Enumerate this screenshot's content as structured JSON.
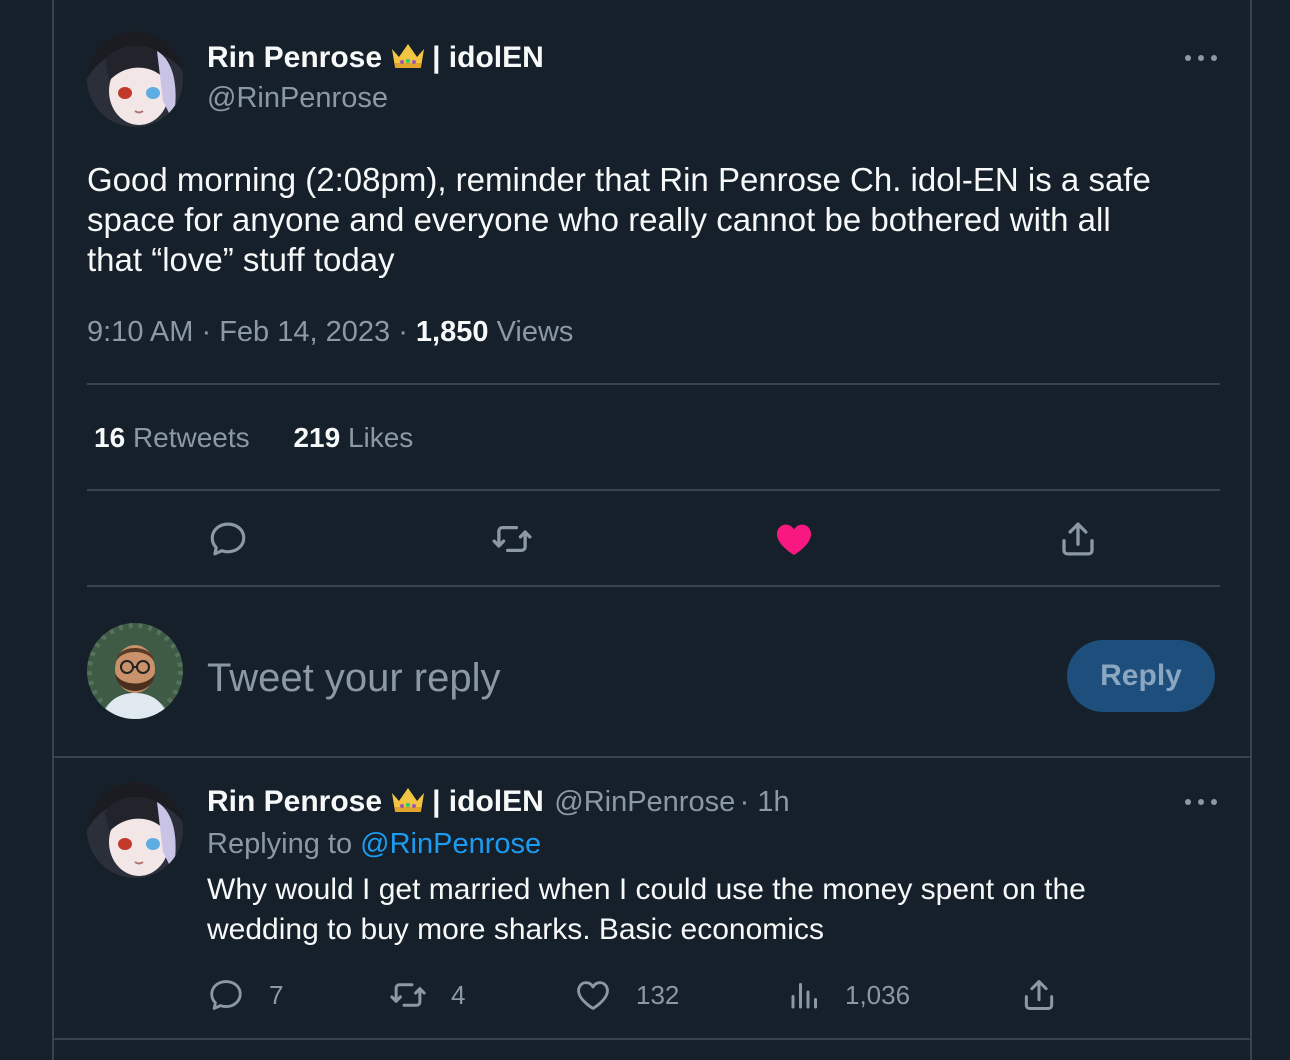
{
  "main_tweet": {
    "display_name": "Rin Penrose",
    "name_suffix": "| idolEN",
    "handle": "@RinPenrose",
    "text_lines": [
      "Good morning (2:08pm), reminder that Rin Penrose Ch. idol-EN is a safe",
      "space for anyone and everyone who really cannot be bothered with all",
      "that “love” stuff today"
    ],
    "time": "9:10 AM",
    "date": "Feb 14, 2023",
    "separator": "·",
    "views_count": "1,850",
    "views_label": "Views",
    "retweets_count": "16",
    "retweets_label": "Retweets",
    "likes_count": "219",
    "likes_label": "Likes",
    "liked": true
  },
  "composer": {
    "placeholder": "Tweet your reply",
    "reply_button": "Reply"
  },
  "reply_tweet": {
    "display_name": "Rin Penrose",
    "name_suffix": "| idolEN",
    "handle": "@RinPenrose",
    "time_ago": "· 1h",
    "replying_to_label": "Replying to",
    "replying_to_handle": "@RinPenrose",
    "text_lines": [
      "Why would I get married when I could use the money spent on the",
      "wedding to buy more sharks. Basic economics"
    ],
    "replies": "7",
    "retweets": "4",
    "likes": "132",
    "views": "1,036"
  },
  "colors": {
    "background": "#15202b",
    "border": "#38444d",
    "muted_text": "#8b98a5",
    "link": "#1d9bf0",
    "like_pink": "#f91880",
    "reply_button_bg": "#1d4e7c"
  },
  "icons": [
    "more-icon",
    "crown-icon",
    "reply-icon",
    "retweet-icon",
    "heart-filled-icon",
    "heart-outline-icon",
    "share-icon",
    "views-icon"
  ]
}
